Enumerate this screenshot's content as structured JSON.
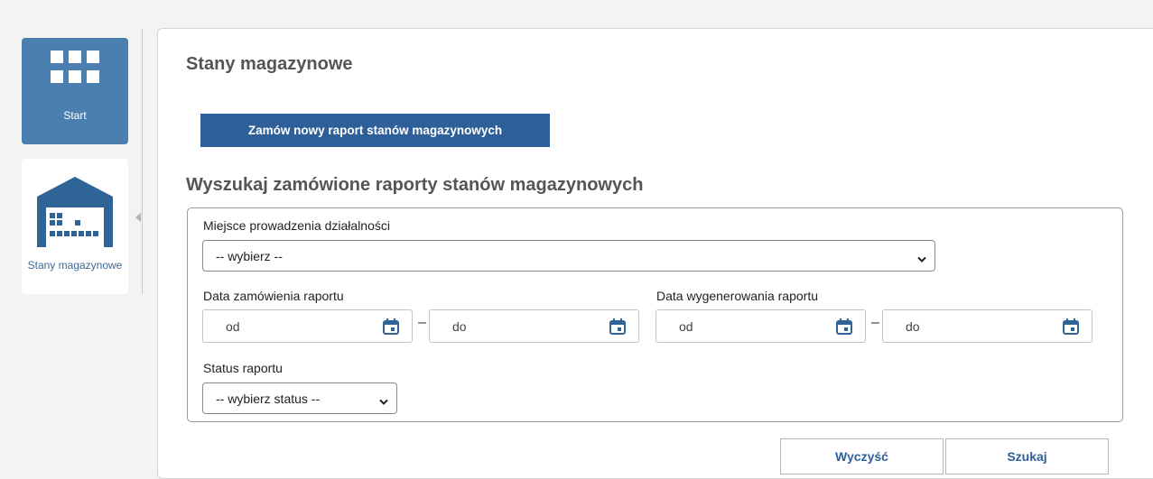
{
  "sidebar": {
    "items": [
      {
        "label": "Start",
        "icon": "grid-icon",
        "active": true
      },
      {
        "label": "Stany magazynowe",
        "icon": "warehouse-icon",
        "active": false
      }
    ]
  },
  "page": {
    "title": "Stany magazynowe"
  },
  "order_button_label": "Zamów nowy raport stanów magazynowych",
  "search": {
    "title": "Wyszukaj zamówione raporty stanów magazynowych",
    "location": {
      "label": "Miejsce prowadzenia działalności",
      "value": "-- wybierz --"
    },
    "order_date": {
      "label": "Data zamówienia raportu",
      "from_placeholder": "od",
      "to_placeholder": "do"
    },
    "generation_date": {
      "label": "Data wygenerowania raportu",
      "from_placeholder": "od",
      "to_placeholder": "do"
    },
    "separator": "–",
    "status": {
      "label": "Status raportu",
      "value": "-- wybierz status --"
    }
  },
  "buttons": {
    "clear": "Wyczyść",
    "search": "Szukaj"
  },
  "colors": {
    "primary": "#2e5f99",
    "tile_active": "#4a7fb0",
    "icon_color": "#2f6496"
  }
}
